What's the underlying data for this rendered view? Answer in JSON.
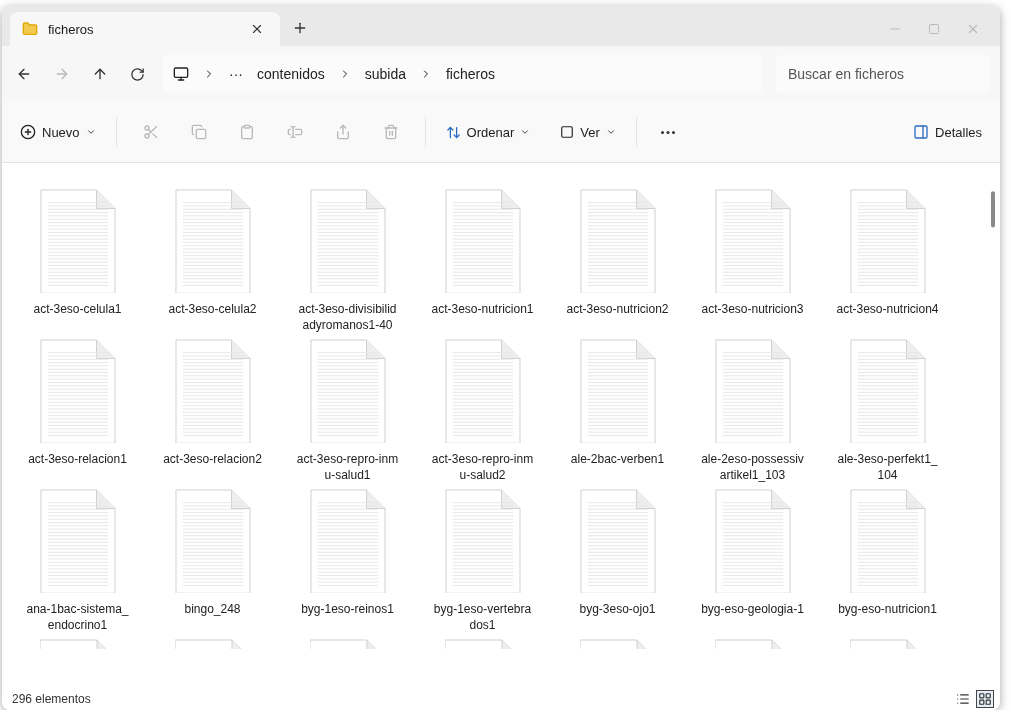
{
  "window": {
    "tab": {
      "title": "ficheros",
      "selected": true
    }
  },
  "nav": {
    "back": {
      "disabled": false
    },
    "forward": {
      "disabled": true
    },
    "overflow": "···",
    "breadcrumb": [
      "contenidos",
      "subida",
      "ficheros"
    ],
    "search": {
      "placeholder": "Buscar en ficheros"
    }
  },
  "toolbar": {
    "new": {
      "label": "Nuevo"
    },
    "actions": [
      {
        "kind": "cut",
        "disabled": true
      },
      {
        "kind": "copy",
        "disabled": true
      },
      {
        "kind": "paste",
        "disabled": true
      },
      {
        "kind": "rename",
        "disabled": true
      },
      {
        "kind": "share",
        "disabled": true
      },
      {
        "kind": "delete",
        "disabled": true
      }
    ],
    "sort": {
      "label": "Ordenar"
    },
    "view": {
      "label": "Ver"
    },
    "details": {
      "label": "Detalles"
    }
  },
  "files": [
    {
      "name": "act-3eso-celula1"
    },
    {
      "name": "act-3eso-celula2"
    },
    {
      "name": "act-3eso-divisibilidadyromanos1-40"
    },
    {
      "name": "act-3eso-nutricion1"
    },
    {
      "name": "act-3eso-nutricion2"
    },
    {
      "name": "act-3eso-nutricion3"
    },
    {
      "name": "act-3eso-nutricion4"
    },
    {
      "name": "act-3eso-relacion1"
    },
    {
      "name": "act-3eso-relacion2"
    },
    {
      "name": "act-3eso-repro-inmu-salud1"
    },
    {
      "name": "act-3eso-repro-inmu-salud2"
    },
    {
      "name": "ale-2bac-verben1"
    },
    {
      "name": "ale-2eso-possessivartikel1_103"
    },
    {
      "name": "ale-3eso-perfekt1_104"
    },
    {
      "name": "ana-1bac-sistema_endocrino1"
    },
    {
      "name": "bingo_248"
    },
    {
      "name": "byg-1eso-reinos1"
    },
    {
      "name": "byg-1eso-vertebrados1"
    },
    {
      "name": "byg-3eso-ojo1"
    },
    {
      "name": "byg-eso-geologia-1"
    },
    {
      "name": "byg-eso-nutricion1"
    }
  ],
  "status_bar": {
    "count": "296 elementos",
    "view_modes": [
      {
        "kind": "list",
        "selected": false
      },
      {
        "kind": "tiles",
        "selected": true
      }
    ]
  }
}
